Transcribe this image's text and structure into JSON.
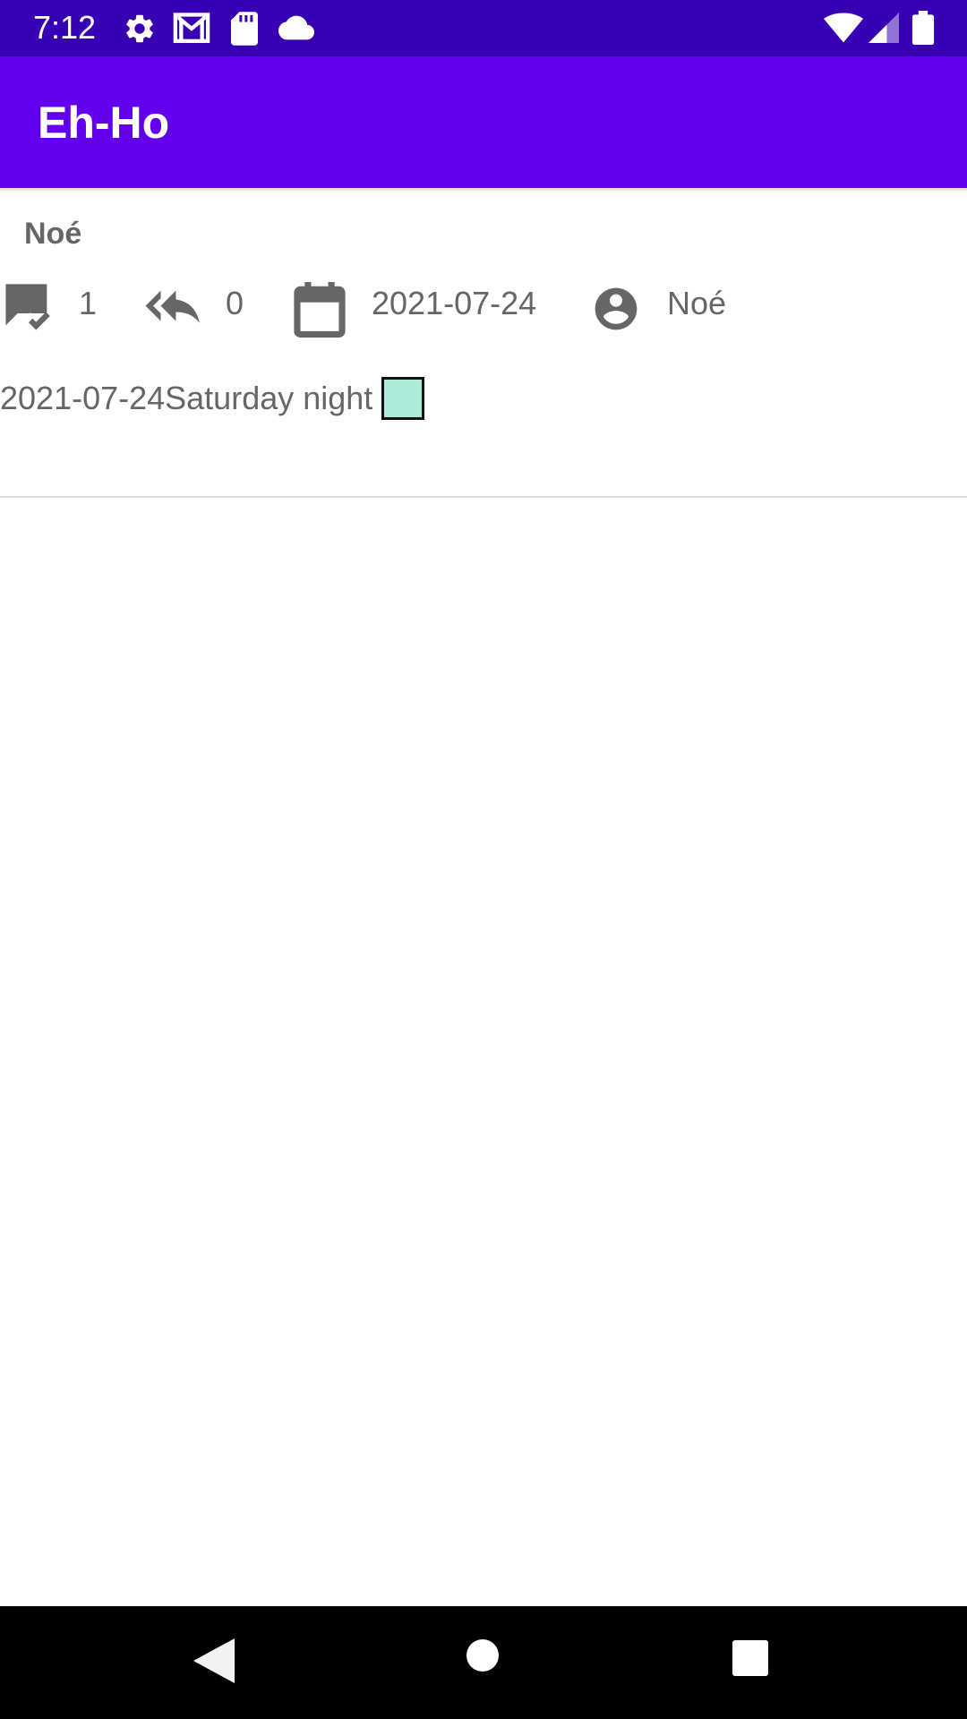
{
  "status_bar": {
    "time": "7:12",
    "background": "#3700b3",
    "icons": [
      "settings-icon",
      "gmail-icon",
      "sd-card-icon",
      "cloud-icon",
      "wifi-icon",
      "signal-icon",
      "battery-icon"
    ]
  },
  "app_bar": {
    "title": "Eh-Ho",
    "background": "#6200ee"
  },
  "topic": {
    "title": "Noé",
    "posts_count": "1",
    "replies_count": "0",
    "date": "2021-07-24",
    "author": "Noé",
    "excerpt": "2021-07-24Saturday night",
    "swatch_color": "#aeeadc",
    "icons": [
      "chat-check-icon",
      "reply-all-icon",
      "calendar-icon",
      "account-circle-icon"
    ]
  },
  "nav_bar": {
    "buttons": [
      "back-icon",
      "home-icon",
      "recents-icon"
    ]
  }
}
